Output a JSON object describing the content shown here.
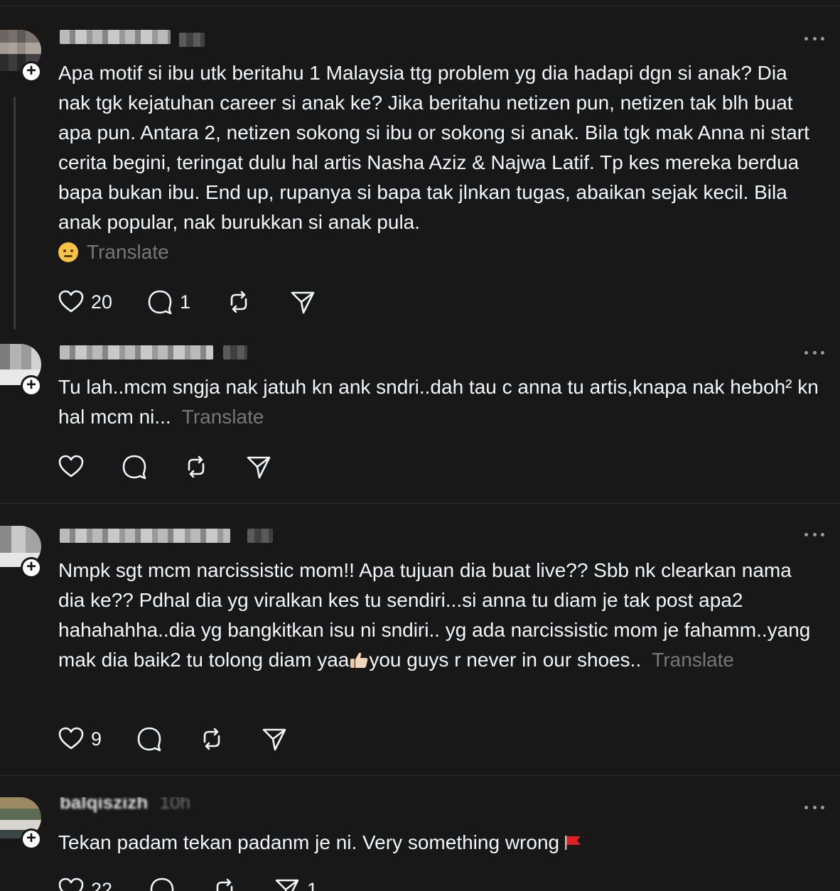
{
  "posts": [
    {
      "body": "Apa motif si ibu utk beritahu 1 Malaysia ttg problem yg dia hadapi dgn si anak? Dia nak tgk kejatuhan career si anak ke? Jika beritahu netizen pun, netizen tak blh buat apa pun. Antara 2, netizen sokong si ibu or sokong si anak. Bila tgk mak Anna ni start cerita begini, teringat dulu hal artis Nasha Aziz & Najwa Latif. Tp kes mereka berdua bapa bukan ibu. End up, rupanya si bapa tak jlnkan tugas, abaikan sejak kecil. Bila anak popular, nak burukkan si anak pula.",
      "emoji": "woozy-face",
      "translate": "Translate",
      "likes": "20",
      "replies": "1",
      "reposts": "",
      "shares": ""
    },
    {
      "body": "Tu lah..mcm sngja nak jatuh kn ank sndri..dah tau c anna tu artis,knapa nak heboh² kn hal mcm ni...",
      "translate": "Translate",
      "likes": "",
      "replies": "",
      "reposts": "",
      "shares": ""
    },
    {
      "body_part1": "Nmpk sgt mcm narcissistic mom!! Apa tujuan dia buat live?? Sbb nk clearkan nama dia ke?? Pdhal dia yg viralkan kes tu sendiri...si anna tu diam je tak post apa2 hahahahha..dia yg bangkitkan isu ni sndiri.. yg ada narcissistic mom je fahamm..yang mak dia baik2 tu tolong diam yaa",
      "emoji": "thumbs-up",
      "body_part2": "you guys r never in our shoes..",
      "translate": "Translate",
      "likes": "9",
      "replies": "",
      "reposts": "",
      "shares": ""
    },
    {
      "username": "balqiszizh",
      "time": "10h",
      "body": "Tekan padam tekan padanm je ni. Very something wrong",
      "emoji": "red-flag",
      "likes": "22",
      "replies": "",
      "reposts": "",
      "shares": "1"
    }
  ]
}
